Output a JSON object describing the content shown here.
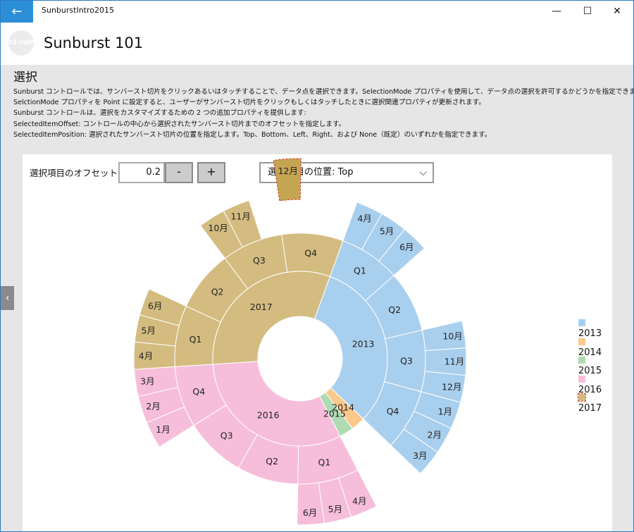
{
  "window": {
    "title": "SunburstIntro2015",
    "back_icon": "←",
    "minimize_icon": "—",
    "maximize_icon": "☐",
    "close_icon": "✕"
  },
  "header": {
    "logo": "C8 UWP",
    "title": "Sunburst 101"
  },
  "page": {
    "heading": "選択",
    "lines": [
      "Sunburst コントロールでは、サンバースト切片をクリックあるいはタッチすることで、データ点を選択できます。SelectionMode プロパティを使用して、データ点の選択を許可するかどうかを指定できます。",
      "SelctionMode プロパティを Point に設定すると、ユーザーがサンバースト切片をクリックもしくはタッチしたときに選択関連プロパティが更新されます。",
      "Sunburst コントロールは、選択をカスタマイズするための 2 つの追加プロパティを提供します:",
      "SelectedItemOffset: コントロールの中心から選択されたサンバースト切片までのオフセットを指定します。",
      "SelectedItemPosition: 選択されたサンバースト切片の位置を指定します。Top、Bottom、Left、Right、および None（既定）のいずれかを指定できます。"
    ]
  },
  "controls": {
    "offset_label": "選択項目のオフセット",
    "offset_value": "0.2",
    "minus_label": "-",
    "plus_label": "+",
    "position_select": "選択項目の位置: Top",
    "chevron": "⌵"
  },
  "colors": {
    "2013": "#a9cfee",
    "2014": "#fbc88c",
    "2015": "#afdbb2",
    "2016": "#f6bedb",
    "2017": "#d4bc80",
    "selected": "#c4a552"
  },
  "chart_data": {
    "type": "sunburst",
    "selected": "2017 Q4 12月",
    "selected_offset": 0.2,
    "selected_position": "Top",
    "legend_position": "right",
    "legend": [
      "2013",
      "2014",
      "2015",
      "2016",
      "2017"
    ],
    "years": [
      {
        "name": "2013",
        "value": 12,
        "quarters": [
          {
            "name": "Q1",
            "months": [
              "4月",
              "5月",
              "6月"
            ]
          },
          {
            "name": "Q2",
            "months": []
          },
          {
            "name": "Q3",
            "months": [
              "10月",
              "11月",
              "12月"
            ]
          },
          {
            "name": "Q4",
            "months": [
              "1月",
              "2月",
              "3月"
            ]
          }
        ]
      },
      {
        "name": "2014",
        "value": 1,
        "quarters": []
      },
      {
        "name": "2015",
        "value": 1,
        "quarters": []
      },
      {
        "name": "2016",
        "value": 12,
        "quarters": [
          {
            "name": "Q1",
            "months": [
              "4月",
              "5月",
              "6月"
            ]
          },
          {
            "name": "Q2",
            "months": []
          },
          {
            "name": "Q3",
            "months": []
          },
          {
            "name": "Q4",
            "months": [
              "1月",
              "2月",
              "3月"
            ]
          }
        ]
      },
      {
        "name": "2017",
        "value": 12,
        "quarters": [
          {
            "name": "Q1",
            "months": [
              "4月",
              "5月",
              "6月"
            ]
          },
          {
            "name": "Q2",
            "months": []
          },
          {
            "name": "Q3",
            "months": [
              "10月",
              "11月"
            ]
          },
          {
            "name": "Q4",
            "months": [
              "12月"
            ]
          }
        ]
      }
    ]
  }
}
